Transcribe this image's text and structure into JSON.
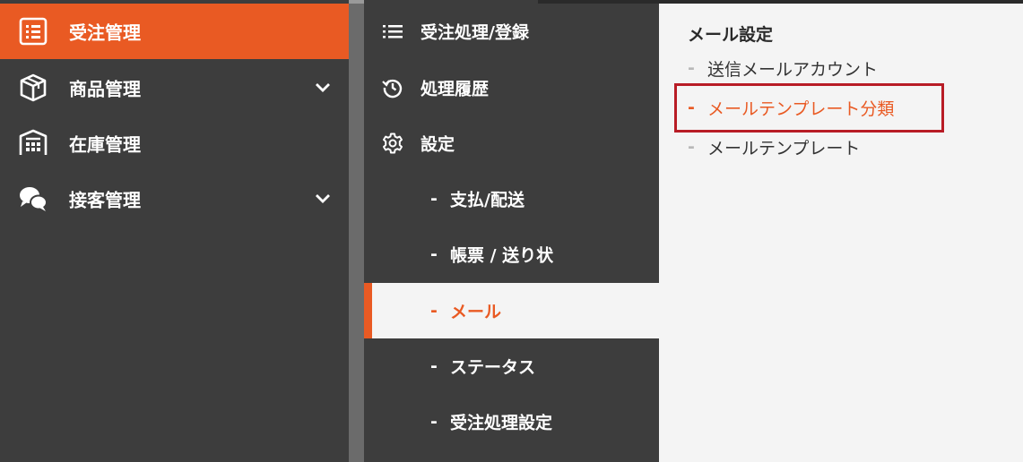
{
  "nav_main": {
    "items": [
      {
        "label": "受注管理",
        "icon": "order-list-icon",
        "active": true
      },
      {
        "label": "商品管理",
        "icon": "box-icon",
        "chevron": true
      },
      {
        "label": "在庫管理",
        "icon": "warehouse-icon"
      },
      {
        "label": "接客管理",
        "icon": "chat-bubbles-icon",
        "chevron": true
      }
    ]
  },
  "nav_sub": {
    "items": [
      {
        "label": "受注処理/登録",
        "icon": "list-icon"
      },
      {
        "label": "処理履歴",
        "icon": "history-icon"
      },
      {
        "label": "設定",
        "icon": "gear-icon"
      }
    ],
    "sub_items": [
      {
        "label": "支払/配送"
      },
      {
        "label": "帳票 / 送り状"
      },
      {
        "label": "メール",
        "active": true
      },
      {
        "label": "ステータス"
      },
      {
        "label": "受注処理設定"
      }
    ],
    "dash": "-"
  },
  "panel": {
    "title": "メール設定",
    "items": [
      {
        "label": "送信メールアカウント"
      },
      {
        "label": "メールテンプレート分類",
        "active": true
      },
      {
        "label": "メールテンプレート"
      }
    ],
    "dash": "-"
  },
  "colors": {
    "accent": "#e95a23",
    "nav_bg": "#3d3d3d",
    "panel_bg": "#f4f4f4",
    "highlight_border": "#b81c25"
  }
}
